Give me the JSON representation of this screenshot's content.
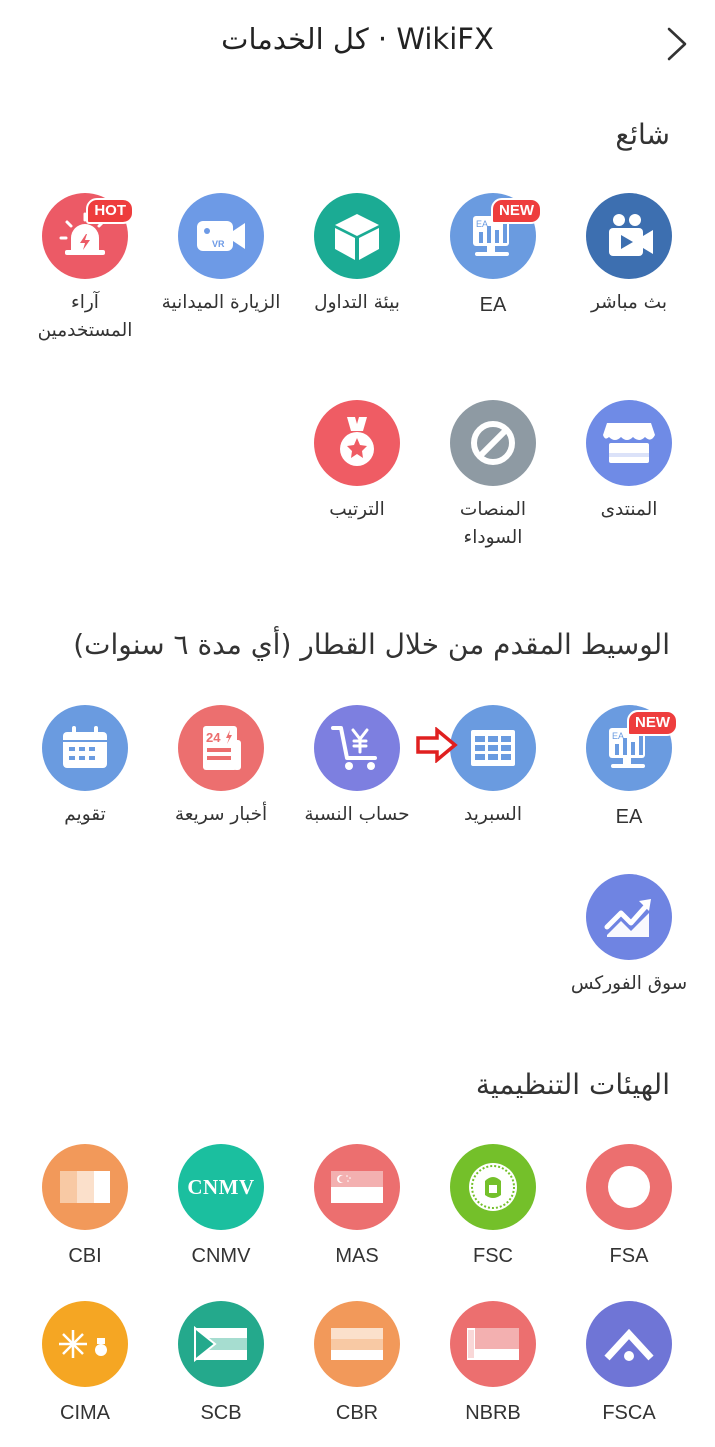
{
  "header": {
    "title": "كل الخدمات · WikiFX"
  },
  "sections": {
    "popular": {
      "title": "شائع",
      "items": [
        {
          "label": "بث مباشر",
          "icon": "video-camera-icon",
          "color": "#3d6fb0"
        },
        {
          "label": "EA",
          "icon": "ea-chart-icon",
          "color": "#6a9be0",
          "badge": "NEW"
        },
        {
          "label": "بيئة التداول",
          "icon": "cube-icon",
          "color": "#1bab94"
        },
        {
          "label": "الزيارة الميدانية",
          "icon": "vr-camera-icon",
          "color": "#6d9ae6"
        },
        {
          "label": "آراء المستخدمين",
          "icon": "alarm-light-icon",
          "color": "#ec5a66",
          "badge": "HOT"
        },
        {
          "label": "المنتدى",
          "icon": "storefront-icon",
          "color": "#6f8be6"
        },
        {
          "label": "المنصات السوداء",
          "icon": "blocked-icon",
          "color": "#8e9aa3"
        },
        {
          "label": "الترتيب",
          "icon": "medal-icon",
          "color": "#ef5c64"
        }
      ]
    },
    "advanced": {
      "title": "الوسيط المقدم من خلال القطار (أي مدة ٦ سنوات)",
      "items": [
        {
          "label": "EA",
          "icon": "ea-chart-icon",
          "color": "#6a9be0",
          "badge": "NEW"
        },
        {
          "label": "السبريد",
          "icon": "table-grid-icon",
          "color": "#6a9be0"
        },
        {
          "label": "حساب النسبة",
          "icon": "yen-cart-icon",
          "color": "#7d7fe0"
        },
        {
          "label": "أخبار سريعة",
          "icon": "news-24-icon",
          "color": "#ec6f6f"
        },
        {
          "label": "تقويم",
          "icon": "calendar-icon",
          "color": "#6a9be0"
        },
        {
          "label": "سوق الفوركس",
          "icon": "trend-up-icon",
          "color": "#6f84e2"
        }
      ]
    },
    "regulators": {
      "title": "الهيئات التنظيمية",
      "items": [
        {
          "label": "FSA",
          "icon": "fsa-logo-icon",
          "color": "#ec6f6f"
        },
        {
          "label": "FSC",
          "icon": "fsc-seal-icon",
          "color": "#74c02a"
        },
        {
          "label": "MAS",
          "icon": "singapore-flag-icon",
          "color": "#ec6f6f"
        },
        {
          "label": "CNMV",
          "icon": "cnmv-text-icon",
          "color": "#1bbf9f"
        },
        {
          "label": "CBI",
          "icon": "ireland-flag-icon",
          "color": "#f2995a"
        },
        {
          "label": "FSCA",
          "icon": "fsca-logo-icon",
          "color": "#6f75d6"
        },
        {
          "label": "NBRB",
          "icon": "belarus-flag-icon",
          "color": "#ec6f6f"
        },
        {
          "label": "CBR",
          "icon": "russia-flag-icon",
          "color": "#f2995a"
        },
        {
          "label": "SCB",
          "icon": "bahamas-flag-icon",
          "color": "#24a98c"
        },
        {
          "label": "CIMA",
          "icon": "cayman-flag-icon",
          "color": "#f5a623"
        }
      ]
    }
  },
  "cnmv_icon_text": "CNMV",
  "news_icon_text": "24",
  "ea_icon_text": "EA",
  "vr_icon_text": "VR"
}
